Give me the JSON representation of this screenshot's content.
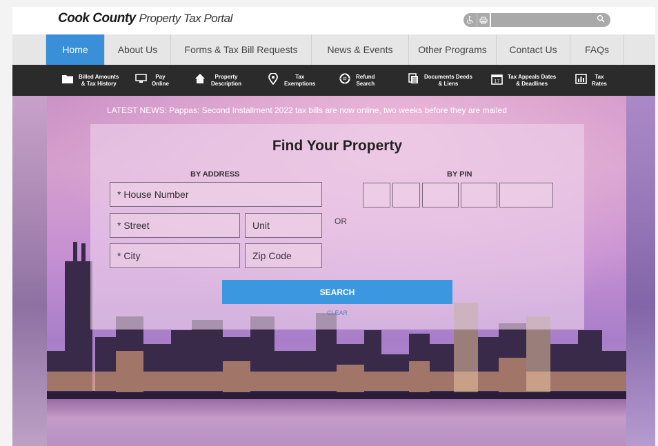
{
  "header": {
    "logo_bold": "Cook County",
    "logo_light": "Property Tax Portal",
    "accessibility_icon": "wheelchair-icon",
    "print_icon": "printer-icon",
    "search_icon": "magnifier-icon"
  },
  "main_nav": {
    "items": [
      {
        "label": "Home",
        "active": true
      },
      {
        "label": "About Us"
      },
      {
        "label": "Forms & Tax Bill Requests"
      },
      {
        "label": "News & Events"
      },
      {
        "label": "Other Programs"
      },
      {
        "label": "Contact Us"
      },
      {
        "label": "FAQs"
      }
    ]
  },
  "icon_bar": {
    "items": [
      {
        "line1": "Billed Amounts",
        "line2": "& Tax History",
        "icon": "folder-icon"
      },
      {
        "line1": "Pay",
        "line2": "Online",
        "icon": "monitor-icon"
      },
      {
        "line1": "Property",
        "line2": "Description",
        "icon": "house-icon"
      },
      {
        "line1": "Tax",
        "line2": "Exemptions",
        "icon": "location-pin-icon"
      },
      {
        "line1": "Refund",
        "line2": "Search",
        "icon": "lifebuoy-icon"
      },
      {
        "line1": "Documents Deeds",
        "line2": "& Liens",
        "icon": "documents-icon"
      },
      {
        "line1": "Tax Appeals Dates",
        "line2": "& Deadlines",
        "icon": "calendar-icon"
      },
      {
        "line1": "Tax",
        "line2": "Rates",
        "icon": "bar-chart-icon"
      }
    ]
  },
  "hero": {
    "news_prefix": "LATEST NEWS:",
    "news_text": "Pappas: Second Installment 2022 tax bills are now online, two weeks before they are mailed"
  },
  "find": {
    "title": "Find Your Property",
    "by_address_label": "BY ADDRESS",
    "by_pin_label": "BY PIN",
    "house_number_placeholder": "* House Number",
    "street_placeholder": "* Street",
    "unit_placeholder": "Unit",
    "city_placeholder": "* City",
    "zip_placeholder": "Zip Code",
    "or_label": "OR",
    "search_label": "SEARCH",
    "clear_label": "CLEAR"
  },
  "colors": {
    "nav_active": "#3a8fd9",
    "icon_bar_bg": "#2b2b2b",
    "search_button": "#3b97df"
  }
}
